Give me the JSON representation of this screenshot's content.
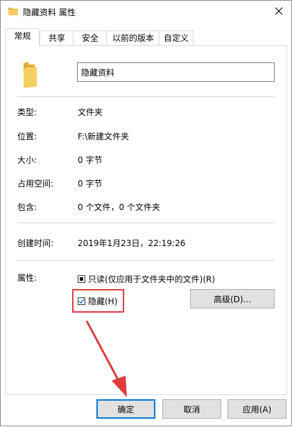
{
  "window": {
    "title": "隐藏资料 属性"
  },
  "tabs": [
    {
      "label": "常规"
    },
    {
      "label": "共享"
    },
    {
      "label": "安全"
    },
    {
      "label": "以前的版本"
    },
    {
      "label": "自定义"
    }
  ],
  "general": {
    "name_value": "隐藏资料",
    "type_label": "类型:",
    "type_value": "文件夹",
    "location_label": "位置:",
    "location_value": "F:\\新建文件夹",
    "size_label": "大小:",
    "size_value": "0 字节",
    "size_on_disk_label": "占用空间:",
    "size_on_disk_value": "0 字节",
    "contains_label": "包含:",
    "contains_value": "0 个文件，0 个文件夹",
    "created_label": "创建时间:",
    "created_value": "2019年1月23日，22:19:26",
    "attributes_label": "属性:",
    "readonly_label": "只读(仅应用于文件夹中的文件)(R)",
    "readonly_state": "indeterminate",
    "hidden_label": "隐藏(H)",
    "hidden_state": "checked",
    "advanced_button": "高级(D)..."
  },
  "footer": {
    "ok": "确定",
    "cancel": "取消",
    "apply": "应用(A)"
  },
  "colors": {
    "accent": "#0078d7",
    "annotation": "#e03c3c",
    "folder": "#f2c94c"
  }
}
